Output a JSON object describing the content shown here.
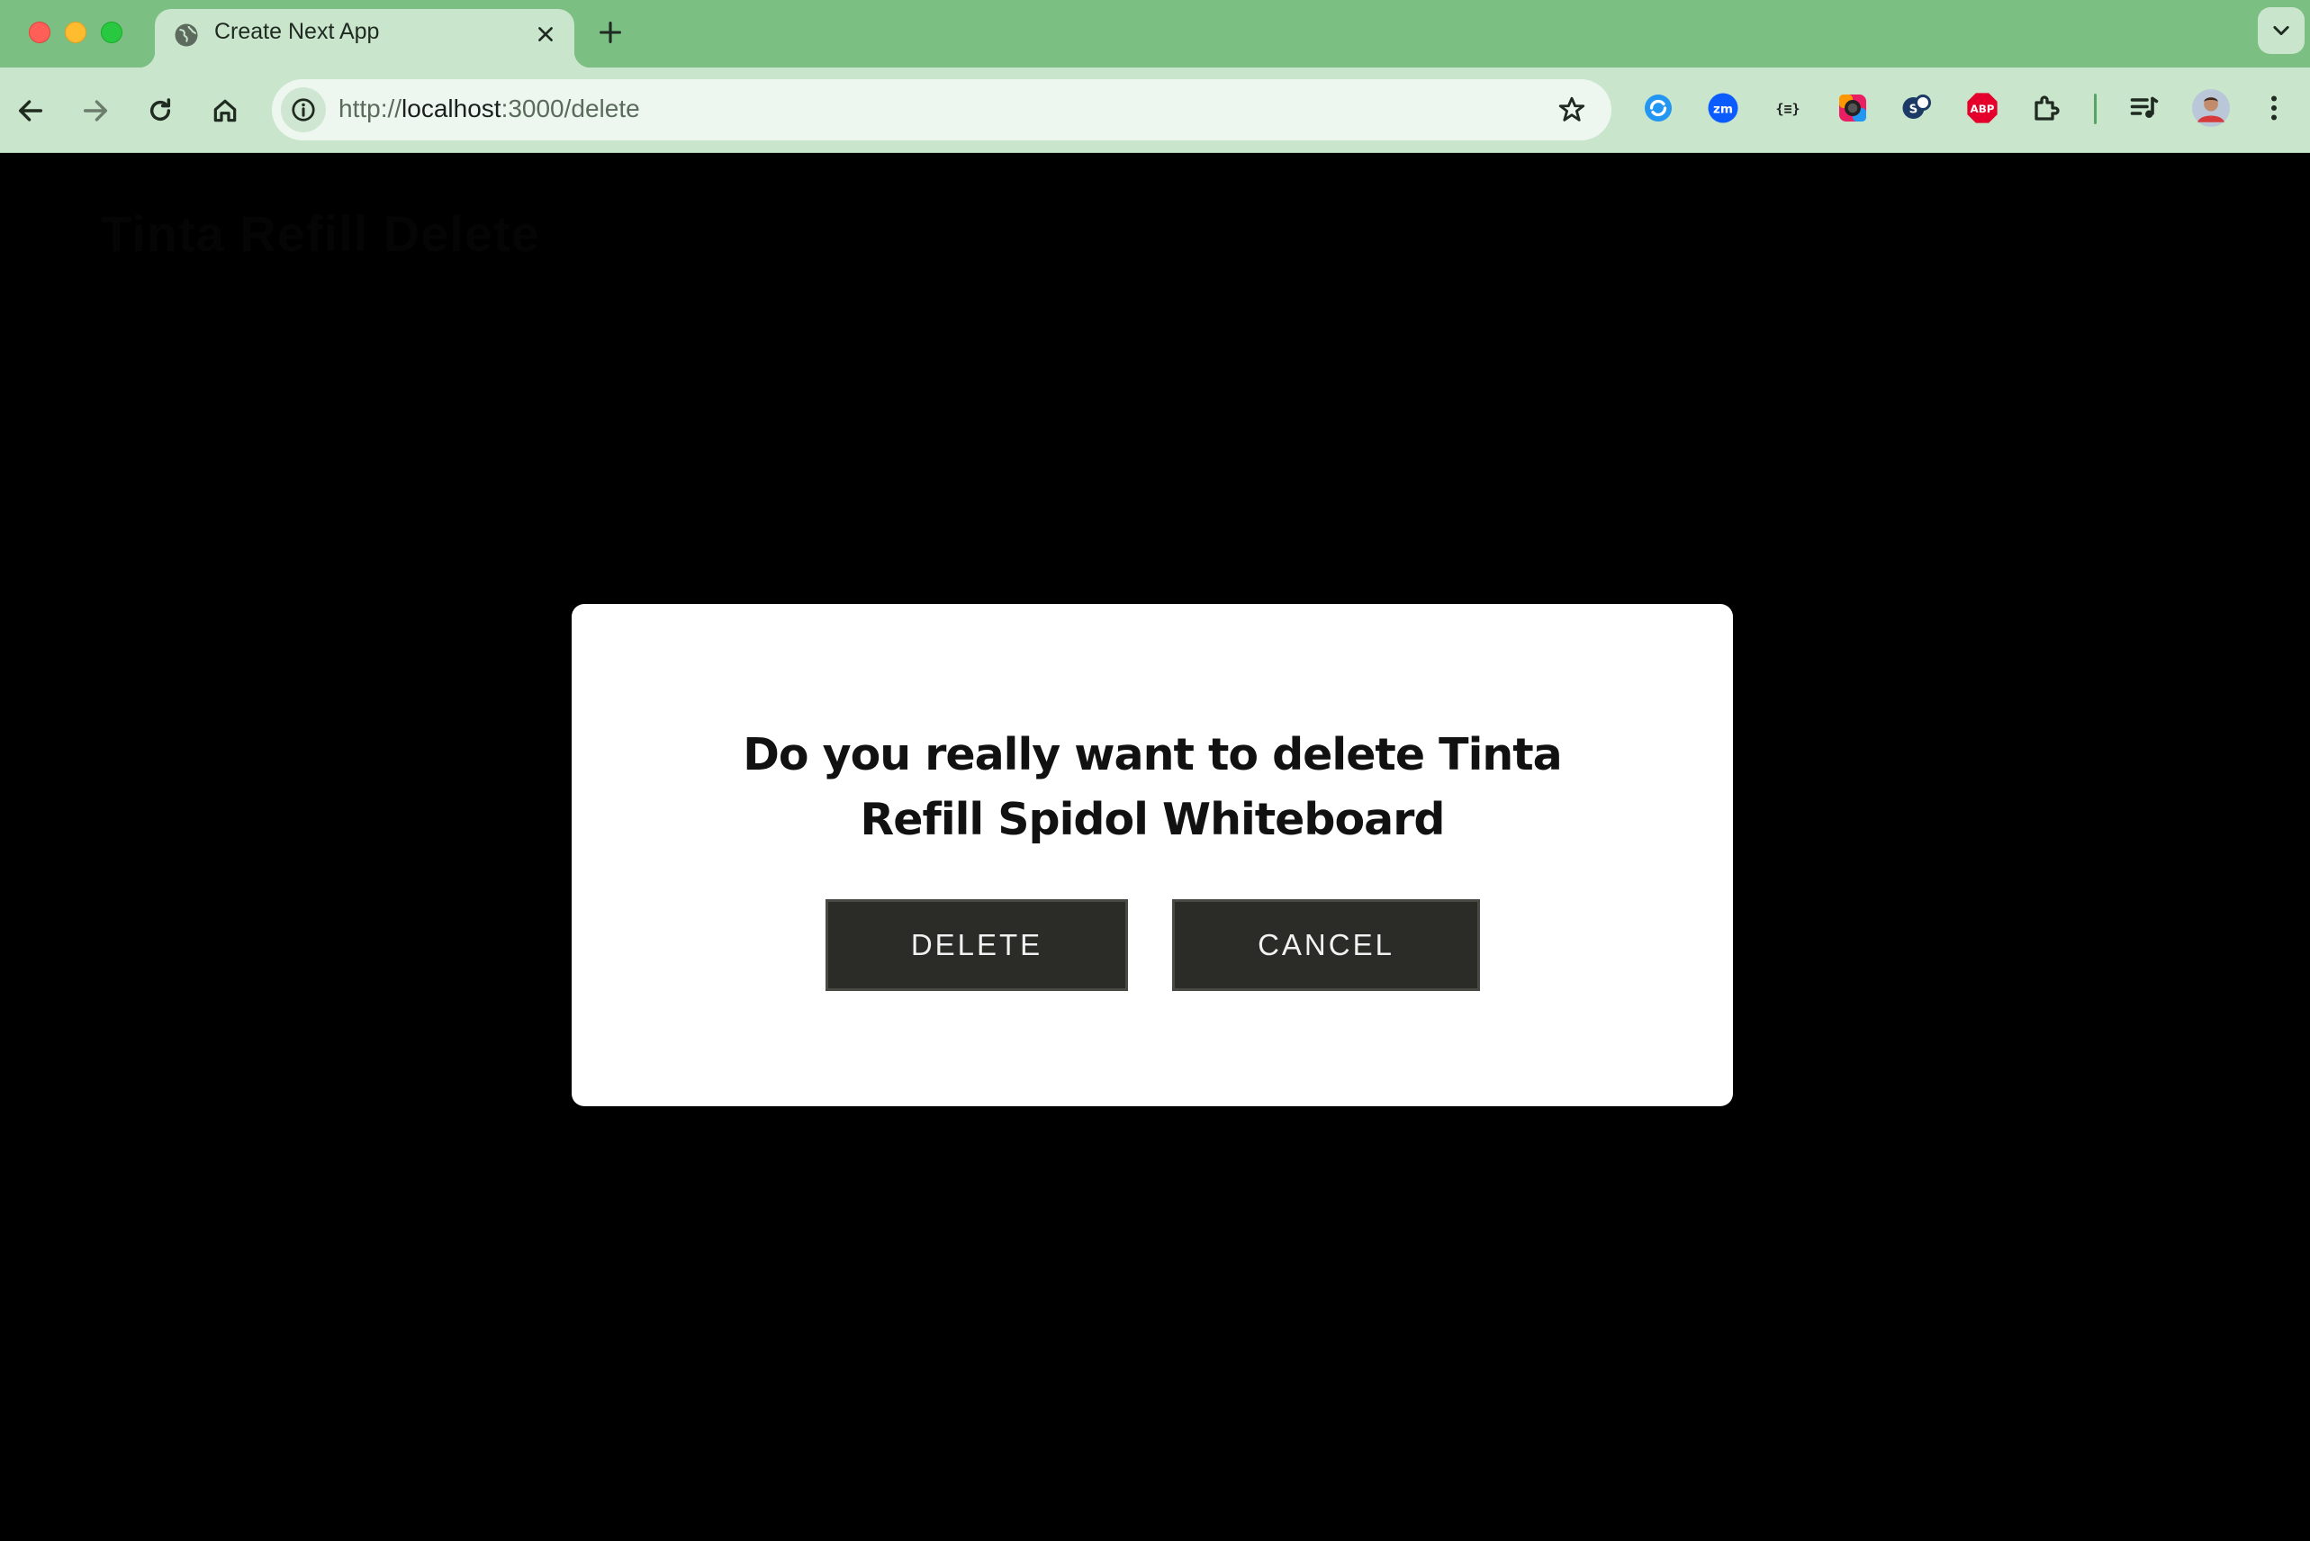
{
  "browser": {
    "tab": {
      "title": "Create Next App"
    },
    "address_bar": {
      "url_scheme": "http://",
      "url_host": "localhost",
      "url_rest": ":3000/delete"
    },
    "extensions": [
      {
        "name": "sync-extension-icon",
        "color": "#2196f3"
      },
      {
        "name": "zoom-extension-icon",
        "label": "zm",
        "color": "#0b5cff"
      },
      {
        "name": "json-formatter-extension-icon",
        "label": "{≡}",
        "color": "#222222"
      },
      {
        "name": "color-picker-extension-icon",
        "color": "#e91e63"
      },
      {
        "name": "seo-extension-icon",
        "color": "#1b3a66"
      },
      {
        "name": "adblock-plus-extension-icon",
        "label": "ABP",
        "color": "#e4002b"
      }
    ]
  },
  "page": {
    "background_heading": "Tinta Refill Delete"
  },
  "dialog": {
    "message": "Do you really want to delete Tinta Refill Spidol Whiteboard",
    "delete_label": "DELETE",
    "cancel_label": "CANCEL"
  },
  "colors": {
    "titlebar": "#7bbf83",
    "toolbar": "#c9e5cc",
    "button": "#2b2b27"
  }
}
